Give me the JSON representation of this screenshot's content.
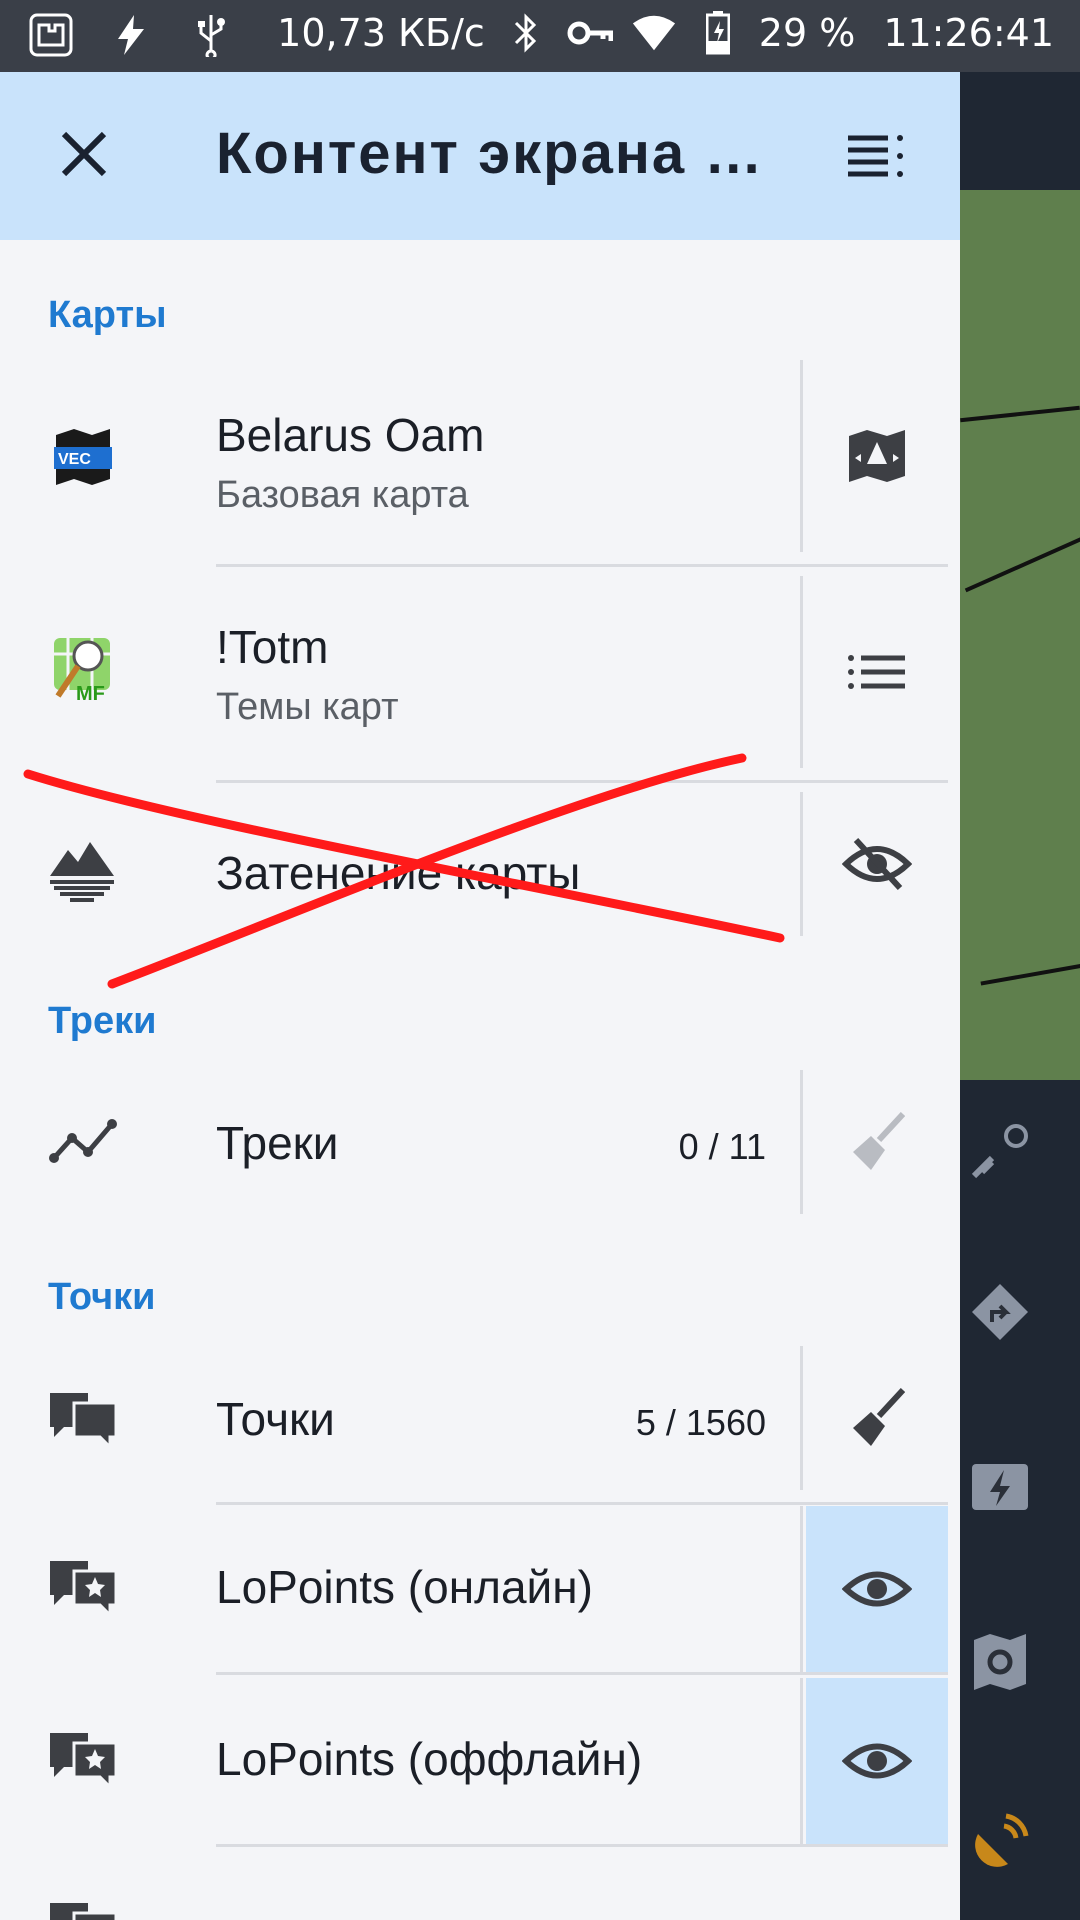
{
  "status_bar": {
    "icons_left": [
      "puzzle-app-icon",
      "flash-icon",
      "usb-icon"
    ],
    "speed": "10,73 КБ/с",
    "icons_right": [
      "bluetooth-icon",
      "vpn-key-icon",
      "wifi-icon",
      "battery-charging-icon"
    ],
    "battery": "29 %",
    "time": "11:26:41"
  },
  "header": {
    "title": "Контент экрана …",
    "close_icon": "close-icon",
    "menu_icon": "menu-list-icon"
  },
  "sections": {
    "maps": "Карты",
    "tracks": "Треки",
    "points": "Точки"
  },
  "rows": {
    "map1": {
      "title": "Belarus Oam",
      "subtitle": "Базовая карта",
      "icon": "vector-map-icon",
      "action_icon": "map-icon"
    },
    "map2": {
      "title": "!Totm",
      "subtitle": "Темы карт",
      "icon": "mapsforge-theme-icon",
      "action_icon": "list-icon"
    },
    "map3": {
      "title": "Затенение карты",
      "icon": "hillshade-icon",
      "action_icon": "eye-off-icon"
    },
    "tracks": {
      "title": "Треки",
      "count": "0 / 11",
      "icon": "track-icon",
      "action_icon": "broom-icon"
    },
    "points": {
      "title": "Точки",
      "count": "5 / 1560",
      "icon": "points-icon",
      "action_icon": "broom-icon"
    },
    "lopoints_online": {
      "title": "LoPoints (онлайн)",
      "icon": "star-points-icon",
      "action_icon": "eye-icon"
    },
    "lopoints_offline": {
      "title": "LoPoints (оффлайн)",
      "icon": "star-points-icon",
      "action_icon": "eye-icon"
    }
  },
  "colors": {
    "header_bg": "#c9e3fb",
    "section_label": "#1f7ad0",
    "strike": "#ff1a1a"
  }
}
